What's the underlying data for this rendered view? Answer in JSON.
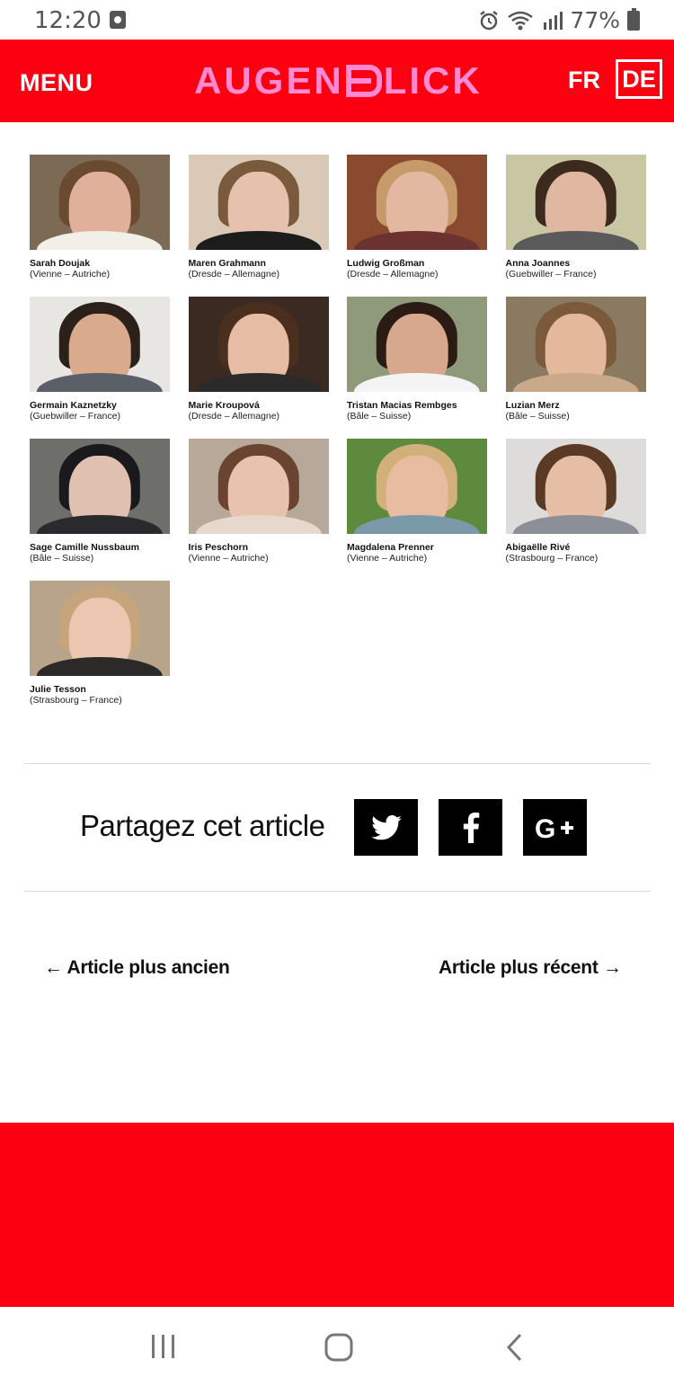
{
  "status_bar": {
    "time": "12:20",
    "battery": "77%",
    "icons": [
      "alarm-icon",
      "wifi-icon",
      "signal-icon",
      "battery-icon"
    ]
  },
  "header": {
    "menu_label": "MENU",
    "logo_left": "AUGEN",
    "logo_right": "LICK",
    "lang_fr": "FR",
    "lang_de": "DE",
    "bg_color": "#fc0012",
    "logo_color": "#ff8ad3"
  },
  "people": [
    {
      "name": "Sarah Doujak",
      "place": "(Vienne – Autriche)",
      "bg": "#7d6a55",
      "skin": "#e0b09a",
      "hair": "#6b4a32",
      "cloth": "#f2efe8"
    },
    {
      "name": "Maren Grahmann",
      "place": "(Dresde – Allemagne)",
      "bg": "#d9c9b6",
      "skin": "#e6c2ae",
      "hair": "#7a5a3c",
      "cloth": "#1c1c1c"
    },
    {
      "name": "Ludwig Großman",
      "place": "(Dresde – Allemagne)",
      "bg": "#8a4a30",
      "skin": "#e2b9a0",
      "hair": "#c79a6a",
      "cloth": "#6b3230"
    },
    {
      "name": "Anna Joannes",
      "place": "(Guebwiller – France)",
      "bg": "#c9c6a4",
      "skin": "#e0b8a2",
      "hair": "#3c2a1e",
      "cloth": "#5a5a5a"
    },
    {
      "name": "Germain Kaznetzky",
      "place": "(Guebwiller – France)",
      "bg": "#e8e6e2",
      "skin": "#d9aa8c",
      "hair": "#2c201a",
      "cloth": "#5b6068"
    },
    {
      "name": "Marie Kroupová",
      "place": "(Dresde – Allemagne)",
      "bg": "#3a2a22",
      "skin": "#e6bca4",
      "hair": "#4a2e1e",
      "cloth": "#2a2a2a"
    },
    {
      "name": "Tristan Macias Rembges",
      "place": "(Bâle – Suisse)",
      "bg": "#8e9a7a",
      "skin": "#d8a88e",
      "hair": "#2a1c14",
      "cloth": "#f4f4f4"
    },
    {
      "name": "Luzian Merz",
      "place": "(Bâle – Suisse)",
      "bg": "#8a7a62",
      "skin": "#e4b89a",
      "hair": "#7a5a3a",
      "cloth": "#caa98a"
    },
    {
      "name": "Sage Camille Nussbaum",
      "place": "(Bâle – Suisse)",
      "bg": "#6e6e6a",
      "skin": "#e0c0b0",
      "hair": "#1a1a1e",
      "cloth": "#2a2a2e"
    },
    {
      "name": "Iris Peschorn",
      "place": "(Vienne – Autriche)",
      "bg": "#b8a89a",
      "skin": "#e8c2ac",
      "hair": "#6a4430",
      "cloth": "#e6d8cc"
    },
    {
      "name": "Magdalena Prenner",
      "place": "(Vienne – Autriche)",
      "bg": "#5e8a3e",
      "skin": "#e8bca0",
      "hair": "#d2b07a",
      "cloth": "#7a9aaa"
    },
    {
      "name": "Abigaëlle Rivé",
      "place": "(Strasbourg – France)",
      "bg": "#dedcda",
      "skin": "#e6bea6",
      "hair": "#5a3a24",
      "cloth": "#8c8e98"
    },
    {
      "name": "Julie Tesson",
      "place": "(Strasbourg – France)",
      "bg": "#b8a48a",
      "skin": "#ecc6b0",
      "hair": "#c6a47c",
      "cloth": "#2c2a28"
    }
  ],
  "share": {
    "label": "Partagez cet article",
    "buttons": [
      "twitter-icon",
      "facebook-icon",
      "google-plus-icon"
    ]
  },
  "article_nav": {
    "older": "← Article plus ancien",
    "newer": "Article plus récent →"
  },
  "footer": {
    "bg_color": "#fc0012"
  }
}
